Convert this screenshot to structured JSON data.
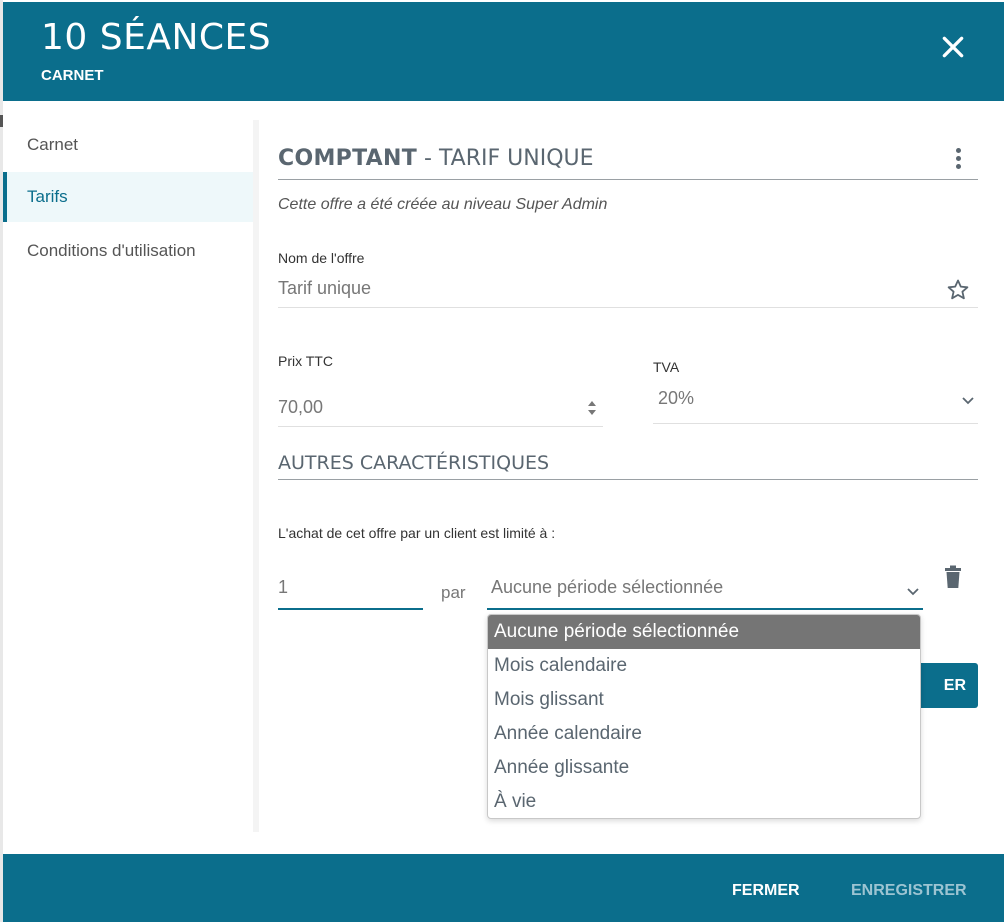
{
  "header": {
    "title": "10 SÉANCES",
    "subtitle": "CARNET"
  },
  "sidebar": {
    "items": [
      {
        "label": "Carnet",
        "active": false
      },
      {
        "label": "Tarifs",
        "active": true
      },
      {
        "label": "Conditions d'utilisation",
        "active": false
      }
    ]
  },
  "section": {
    "title_bold": "COMPTANT",
    "title_rest": " - TARIF UNIQUE",
    "note": "Cette offre a été créée au niveau Super Admin"
  },
  "form": {
    "offer_name_label": "Nom de l'offre",
    "offer_name_value": "Tarif unique",
    "price_label": "Prix TTC",
    "price_value": "70,00",
    "vat_label": "TVA",
    "vat_value": "20%"
  },
  "other": {
    "title": "AUTRES CARACTÉRISTIQUES",
    "limit_label": "L'achat de cet offre par un client est limité à :",
    "quantity_value": "1",
    "per_label": "par",
    "period_value": "Aucune période sélectionnée",
    "partial_button_label": "ER"
  },
  "dropdown": {
    "options": [
      {
        "label": "Aucune période sélectionnée",
        "selected": true
      },
      {
        "label": "Mois calendaire",
        "selected": false
      },
      {
        "label": "Mois glissant",
        "selected": false
      },
      {
        "label": "Année calendaire",
        "selected": false
      },
      {
        "label": "Année glissante",
        "selected": false
      },
      {
        "label": "À vie",
        "selected": false
      }
    ]
  },
  "footer": {
    "close_label": "FERMER",
    "save_label": "ENREGISTRER"
  },
  "colors": {
    "primary": "#0b6e8c",
    "selected_option": "#757575"
  }
}
